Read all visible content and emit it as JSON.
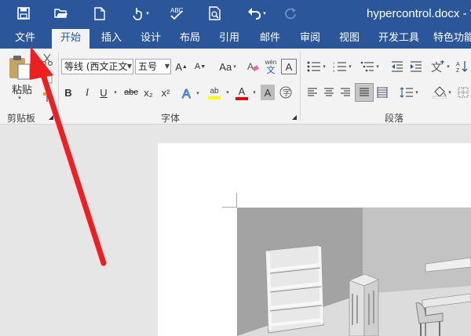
{
  "window": {
    "title": "hypercontrol.docx - V"
  },
  "quick_access": [
    "save-icon",
    "open-icon",
    "new-document-icon",
    "touch-mode-icon",
    "spelling-icon",
    "print-preview-icon",
    "undo-icon",
    "redo-icon"
  ],
  "tabs": [
    {
      "label": "文件"
    },
    {
      "label": "开始"
    },
    {
      "label": "插入"
    },
    {
      "label": "设计"
    },
    {
      "label": "布局"
    },
    {
      "label": "引用"
    },
    {
      "label": "邮件"
    },
    {
      "label": "审阅"
    },
    {
      "label": "视图"
    },
    {
      "label": "开发工具"
    },
    {
      "label": "特色功能"
    }
  ],
  "active_tab": "开始",
  "clipboard": {
    "paste_label": "粘贴",
    "group_label": "剪贴板"
  },
  "font": {
    "font_name": "等线 (西文正文",
    "font_size": "五号",
    "change_case": "Aa",
    "phonetic_top": "wén",
    "phonetic_bottom": "文",
    "bold": "B",
    "italic": "I",
    "underline": "U",
    "strikethrough": "abc",
    "subscript": "x₂",
    "superscript": "x²",
    "highlight": "ab",
    "font_color": "A",
    "group_label": "字体"
  },
  "paragraph": {
    "group_label": "段落"
  },
  "colors": {
    "title_bar": "#2b579a",
    "ribbon_bg": "#f3f3f3",
    "highlight_yellow": "#ffff00",
    "font_red": "#e00000",
    "arrow_red": "#f01e1e"
  }
}
